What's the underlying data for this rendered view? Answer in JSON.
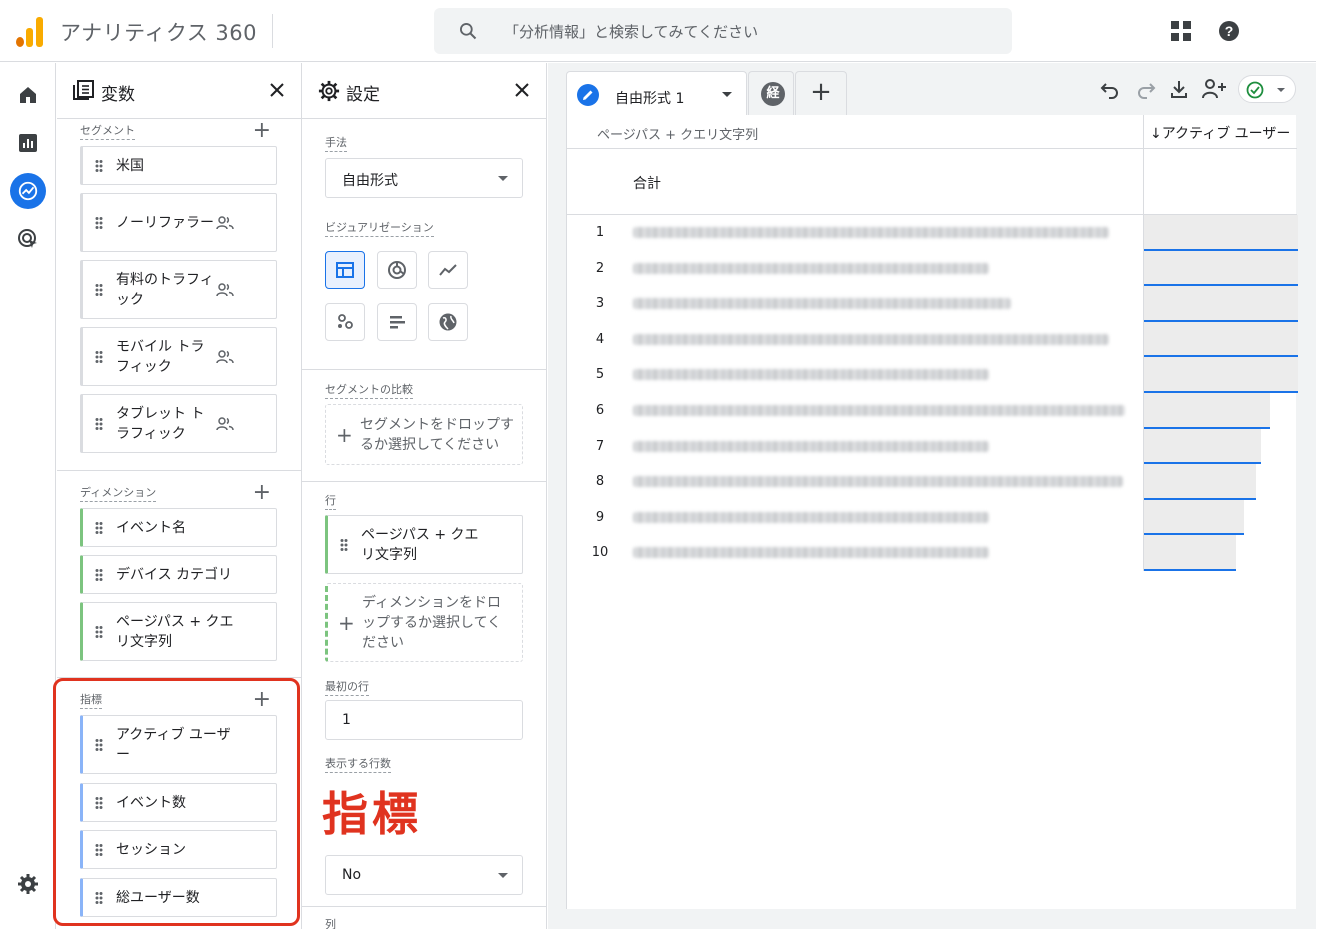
{
  "app": {
    "title": "アナリティクス 360"
  },
  "search": {
    "placeholder": "「分析情報」と検索してみてください"
  },
  "colors": {
    "accent": "#1a73e8",
    "dimension": "#7cc47f",
    "metric": "#8ab4f8",
    "highlight": "#e0331f",
    "logo": [
      "#f9ab00",
      "#e37400",
      "#e37400"
    ]
  },
  "variables": {
    "title": "変数",
    "segments": {
      "label": "セグメント",
      "items": [
        {
          "label": "米国",
          "icon": ""
        },
        {
          "label": "ノーリファラー",
          "icon": "people-icon"
        },
        {
          "label": "有料のトラフィック",
          "icon": "people-icon"
        },
        {
          "label": "モバイル トラフィック",
          "icon": "people-icon"
        },
        {
          "label": "タブレット トラフィック",
          "icon": "people-icon"
        }
      ]
    },
    "dimensions": {
      "label": "ディメンション",
      "items": [
        "イベント名",
        "デバイス カテゴリ",
        "ページパス + クエリ文字列"
      ]
    },
    "metrics": {
      "label": "指標",
      "items": [
        "アクティブ ユーザー",
        "イベント数",
        "セッション",
        "総ユーザー数"
      ]
    }
  },
  "settings": {
    "title": "設定",
    "technique_label": "手法",
    "technique_value": "自由形式",
    "visualization_label": "ビジュアリゼーション",
    "segment_compare_label": "セグメントの比較",
    "segment_drop_text": "セグメントをドロップするか選択してください",
    "rows_label": "行",
    "row_item": "ページパス + クエリ文字列",
    "dimension_drop_text": "ディメンションをドロップするか選択してください",
    "first_row_label": "最初の行",
    "first_row_value": "1",
    "rows_shown_label": "表示する行数",
    "nested_value": "No",
    "columns_label": "列"
  },
  "annotation": {
    "text": "指標"
  },
  "canvas": {
    "tab_name": "自由形式 1",
    "tab2_badge": "経",
    "add_tab": "+",
    "table": {
      "col1": "ページパス + クエリ文字列",
      "col2": "↓アクティブ ユーザー",
      "total_label": "合計",
      "rows": [
        {
          "n": "1",
          "value": 1.0
        },
        {
          "n": "2",
          "value": 1.0
        },
        {
          "n": "3",
          "value": 1.0
        },
        {
          "n": "4",
          "value": 1.0
        },
        {
          "n": "5",
          "value": 1.0
        },
        {
          "n": "6",
          "value": 0.82
        },
        {
          "n": "7",
          "value": 0.76
        },
        {
          "n": "8",
          "value": 0.73
        },
        {
          "n": "9",
          "value": 0.65
        },
        {
          "n": "10",
          "value": 0.6
        }
      ]
    }
  }
}
